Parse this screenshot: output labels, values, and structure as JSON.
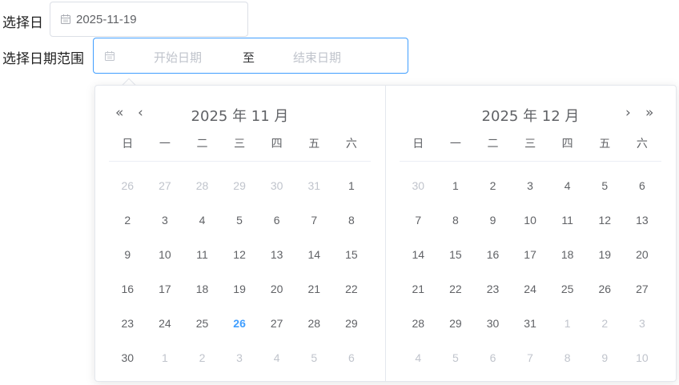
{
  "single": {
    "label": "选择日",
    "value": "2025-11-19"
  },
  "range": {
    "label": "选择日期范围",
    "start_placeholder": "开始日期",
    "separator": "至",
    "end_placeholder": "结束日期"
  },
  "icons": {
    "calendar": "calendar-icon",
    "prev_year": "double-chevron-left-icon",
    "prev_month": "chevron-left-icon",
    "next_month": "chevron-right-icon",
    "next_year": "double-chevron-right-icon"
  },
  "nav": {
    "prev_year": "«",
    "prev_month": "‹",
    "next_month": "›",
    "next_year": "»"
  },
  "colors": {
    "accent": "#409eff",
    "text": "#606266",
    "muted": "#c0c4cc",
    "border": "#dcdfe6"
  },
  "weekdays": [
    "日",
    "一",
    "二",
    "三",
    "四",
    "五",
    "六"
  ],
  "left_month": {
    "title": "2025 年 11 月",
    "weeks": [
      [
        {
          "d": "26",
          "o": true
        },
        {
          "d": "27",
          "o": true
        },
        {
          "d": "28",
          "o": true
        },
        {
          "d": "29",
          "o": true
        },
        {
          "d": "30",
          "o": true
        },
        {
          "d": "31",
          "o": true
        },
        {
          "d": "1"
        }
      ],
      [
        {
          "d": "2"
        },
        {
          "d": "3"
        },
        {
          "d": "4"
        },
        {
          "d": "5"
        },
        {
          "d": "6"
        },
        {
          "d": "7"
        },
        {
          "d": "8"
        }
      ],
      [
        {
          "d": "9"
        },
        {
          "d": "10"
        },
        {
          "d": "11"
        },
        {
          "d": "12"
        },
        {
          "d": "13"
        },
        {
          "d": "14"
        },
        {
          "d": "15"
        }
      ],
      [
        {
          "d": "16"
        },
        {
          "d": "17"
        },
        {
          "d": "18"
        },
        {
          "d": "19"
        },
        {
          "d": "20"
        },
        {
          "d": "21"
        },
        {
          "d": "22"
        }
      ],
      [
        {
          "d": "23"
        },
        {
          "d": "24"
        },
        {
          "d": "25"
        },
        {
          "d": "26",
          "t": true
        },
        {
          "d": "27"
        },
        {
          "d": "28"
        },
        {
          "d": "29"
        }
      ],
      [
        {
          "d": "30"
        },
        {
          "d": "1",
          "o": true
        },
        {
          "d": "2",
          "o": true
        },
        {
          "d": "3",
          "o": true
        },
        {
          "d": "4",
          "o": true
        },
        {
          "d": "5",
          "o": true
        },
        {
          "d": "6",
          "o": true
        }
      ]
    ]
  },
  "right_month": {
    "title": "2025 年 12 月",
    "weeks": [
      [
        {
          "d": "30",
          "o": true
        },
        {
          "d": "1"
        },
        {
          "d": "2"
        },
        {
          "d": "3"
        },
        {
          "d": "4"
        },
        {
          "d": "5"
        },
        {
          "d": "6"
        }
      ],
      [
        {
          "d": "7"
        },
        {
          "d": "8"
        },
        {
          "d": "9"
        },
        {
          "d": "10"
        },
        {
          "d": "11"
        },
        {
          "d": "12"
        },
        {
          "d": "13"
        }
      ],
      [
        {
          "d": "14"
        },
        {
          "d": "15"
        },
        {
          "d": "16"
        },
        {
          "d": "17"
        },
        {
          "d": "18"
        },
        {
          "d": "19"
        },
        {
          "d": "20"
        }
      ],
      [
        {
          "d": "21"
        },
        {
          "d": "22"
        },
        {
          "d": "23"
        },
        {
          "d": "24"
        },
        {
          "d": "25"
        },
        {
          "d": "26"
        },
        {
          "d": "27"
        }
      ],
      [
        {
          "d": "28"
        },
        {
          "d": "29"
        },
        {
          "d": "30"
        },
        {
          "d": "31"
        },
        {
          "d": "1",
          "o": true
        },
        {
          "d": "2",
          "o": true
        },
        {
          "d": "3",
          "o": true
        }
      ],
      [
        {
          "d": "4",
          "o": true
        },
        {
          "d": "5",
          "o": true
        },
        {
          "d": "6",
          "o": true
        },
        {
          "d": "7",
          "o": true
        },
        {
          "d": "8",
          "o": true
        },
        {
          "d": "9",
          "o": true
        },
        {
          "d": "10",
          "o": true
        }
      ]
    ]
  }
}
